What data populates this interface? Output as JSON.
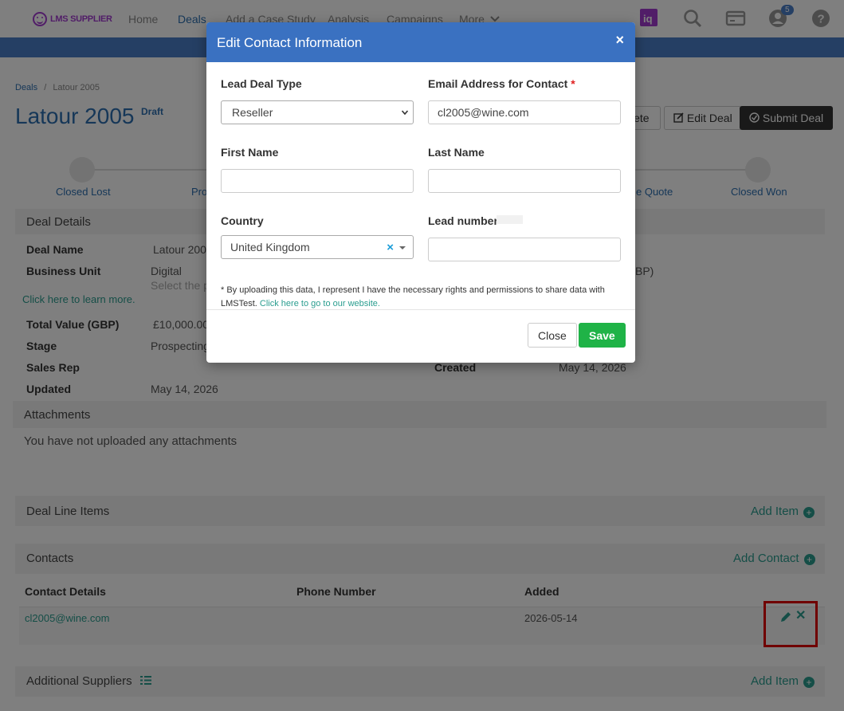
{
  "nav": {
    "logo_text": "LMS SUPPLIER",
    "links": [
      "Home",
      "Deals",
      "Add a Case Study",
      "Analysis",
      "Campaigns",
      "More"
    ],
    "active_link": "Deals",
    "notification_count": "5",
    "icons": [
      "iq-icon",
      "search-icon",
      "card-icon",
      "user-icon",
      "help-icon"
    ]
  },
  "breadcrumb": {
    "root": "Deals",
    "separator": "/",
    "current": "Latour 2005"
  },
  "page": {
    "title": "Latour 2005",
    "status": "Draft",
    "buttons": {
      "delete": "lete",
      "edit": "Edit Deal",
      "submit": "Submit Deal"
    }
  },
  "stages": [
    "Closed Lost",
    "Pro",
    "e Quote",
    "Closed Won"
  ],
  "deal_details": {
    "heading": "Deal Details",
    "deal_name_label": "Deal Name",
    "deal_name": "Latour 2005",
    "business_unit_label": "Business Unit",
    "business_unit": "Digital",
    "business_unit_hint": "Select the pi",
    "learn_more": "Click here to learn more.",
    "currency_hint": "BP)",
    "total_value_label": "Total Value (GBP)",
    "total_value": "£10,000.00",
    "stage_label": "Stage",
    "stage": "Prospecting",
    "sales_rep_label": "Sales Rep",
    "sales_rep": "",
    "created_label": "Created",
    "created": "May 14, 2026",
    "updated_label": "Updated",
    "updated": "May 14, 2026"
  },
  "attachments": {
    "heading": "Attachments",
    "empty_text": "You have not uploaded any attachments"
  },
  "line_items": {
    "heading": "Deal Line Items",
    "add_label": "Add Item"
  },
  "contacts": {
    "heading": "Contacts",
    "add_label": "Add Contact",
    "columns": [
      "Contact Details",
      "Phone Number",
      "Added"
    ],
    "rows": [
      {
        "email": "cl2005@wine.com",
        "phone": "",
        "added": "2026-05-14"
      }
    ]
  },
  "suppliers": {
    "heading": "Additional Suppliers",
    "add_label": "Add Item"
  },
  "modal": {
    "title": "Edit Contact Information",
    "close_symbol": "×",
    "lead_deal_type_label": "Lead Deal Type",
    "lead_deal_type_value": "Reseller",
    "lead_deal_type_options": [
      "Reseller"
    ],
    "email_label": "Email Address for Contact",
    "required_mark": "*",
    "email_value": "cl2005@wine.com",
    "first_name_label": "First Name",
    "first_name_value": "",
    "last_name_label": "Last Name",
    "last_name_value": "",
    "country_label": "Country",
    "country_value": "United Kingdom",
    "lead_number_label": "Lead number",
    "lead_number_value": "",
    "disclaimer_text": "* By uploading this data, I represent I have the necessary rights and permissions to share data with LMSTest.",
    "disclaimer_link": "Click here to go to our website.",
    "close_button": "Close",
    "save_button": "Save"
  },
  "colors": {
    "primary_blue": "#3a71c1",
    "teal_link": "#2a9d8f",
    "save_green": "#1fb347",
    "highlight_red": "#e00000",
    "logo_purple": "#a23bd0"
  }
}
